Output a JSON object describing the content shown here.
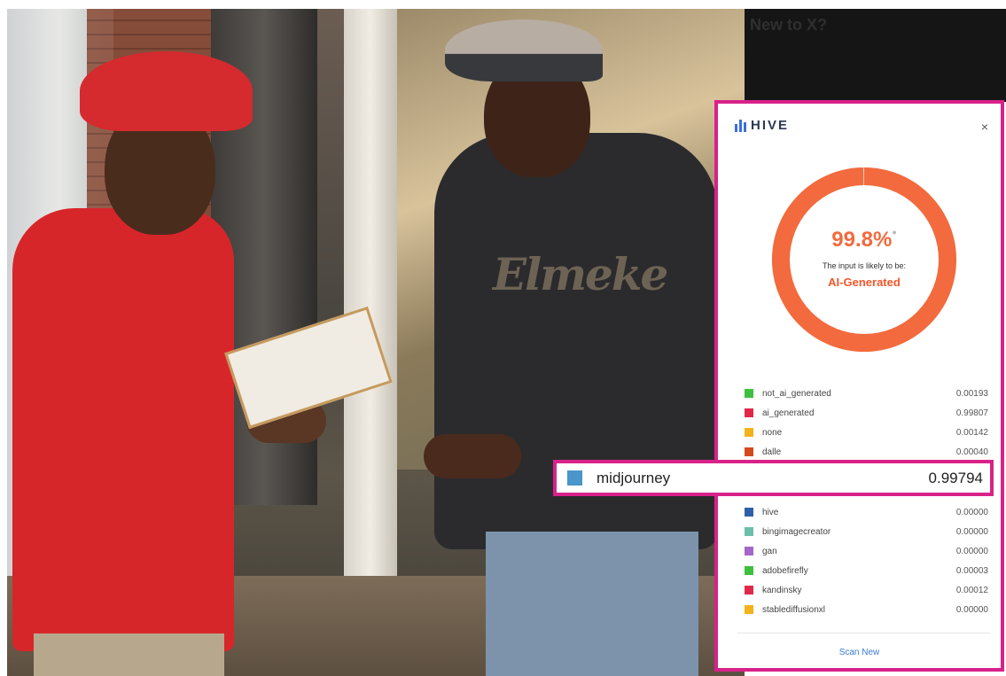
{
  "sidebar_bg": {
    "title": "New to X?",
    "subtitle": "",
    "button": ""
  },
  "photo": {
    "shirt_print": "Elmeke"
  },
  "hive": {
    "brand": "HIVE",
    "close_glyph": "×",
    "score": "99.8%",
    "score_fraction": 0.998,
    "score_info_glyph": "●",
    "likely_text": "The input is likely to be:",
    "verdict": "AI-Generated",
    "accent_color": "#f26a3d",
    "rows_top": [
      {
        "label": "not_ai_generated",
        "value": "0.00193",
        "color": "#3fbf3f"
      },
      {
        "label": "ai_generated",
        "value": "0.99807",
        "color": "#e0284a"
      },
      {
        "label": "none",
        "value": "0.00142",
        "color": "#f2b21b"
      },
      {
        "label": "dalle",
        "value": "0.00040",
        "color": "#d24a1e"
      }
    ],
    "rows_bottom": [
      {
        "label": "hive",
        "value": "0.00000",
        "color": "#2e5fa8"
      },
      {
        "label": "bingimagecreator",
        "value": "0.00000",
        "color": "#6cbfaa"
      },
      {
        "label": "gan",
        "value": "0.00000",
        "color": "#a566c9"
      },
      {
        "label": "adobefirefly",
        "value": "0.00003",
        "color": "#3fbf3f"
      },
      {
        "label": "kandinsky",
        "value": "0.00012",
        "color": "#e0284a"
      },
      {
        "label": "stablediffusionxl",
        "value": "0.00000",
        "color": "#f2b21b"
      }
    ],
    "scan_new": "Scan New"
  },
  "highlight": {
    "label": "midjourney",
    "value": "0.99794",
    "color": "#4a95c9",
    "border_color": "#d9218a"
  }
}
